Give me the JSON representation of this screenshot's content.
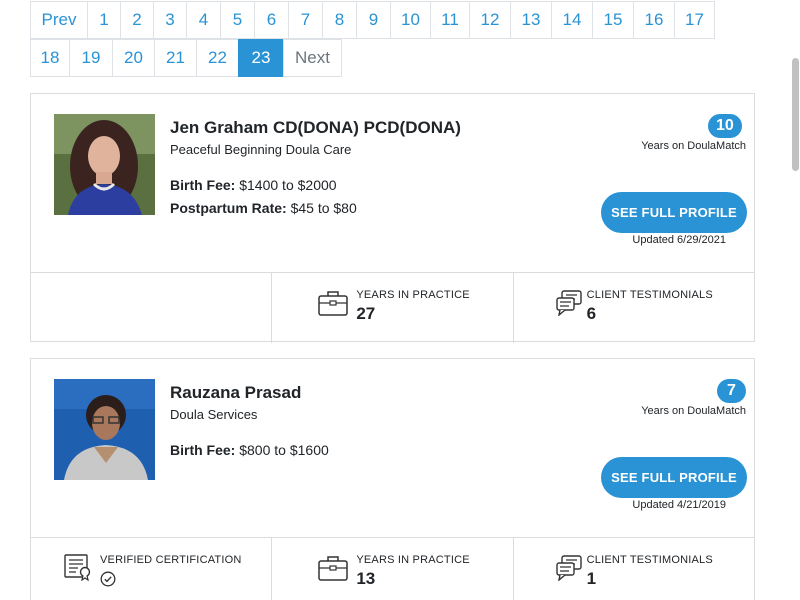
{
  "pagination": {
    "row1": [
      "Prev",
      "1",
      "2",
      "3",
      "4",
      "5",
      "6",
      "7",
      "8",
      "9",
      "10",
      "11",
      "12",
      "13",
      "14",
      "15",
      "16",
      "17"
    ],
    "row2": [
      "18",
      "19",
      "20",
      "21",
      "22",
      "23",
      "Next"
    ],
    "active": "23"
  },
  "doulas": [
    {
      "name": "Jen Graham CD(DONA) PCD(DONA)",
      "agency": "Peaceful Beginning Doula Care",
      "birth_fee_label": "Birth Fee:",
      "birth_fee_value": "$1400 to $2000",
      "postpartum_label": "Postpartum Rate:",
      "postpartum_value": "$45 to $80",
      "years_on_site": "10",
      "years_on_site_label": "Years on DoulaMatch",
      "profile_button": "SEE FULL PROFILE",
      "updated": "Updated 6/29/2021",
      "years_in_practice_label": "YEARS IN PRACTICE",
      "years_in_practice": "27",
      "testimonials_label": "CLIENT TESTIMONIALS",
      "testimonials": "6"
    },
    {
      "name": "Rauzana Prasad",
      "agency": "Doula Services",
      "birth_fee_label": "Birth Fee:",
      "birth_fee_value": "$800 to $1600",
      "years_on_site": "7",
      "years_on_site_label": "Years on DoulaMatch",
      "profile_button": "SEE FULL PROFILE",
      "updated": "Updated 4/21/2019",
      "verified_label": "VERIFIED CERTIFICATION",
      "years_in_practice_label": "YEARS IN PRACTICE",
      "years_in_practice": "13",
      "testimonials_label": "CLIENT TESTIMONIALS",
      "testimonials": "1"
    }
  ],
  "colors": {
    "accent": "#2a93d5",
    "border": "#dcdcdc"
  }
}
